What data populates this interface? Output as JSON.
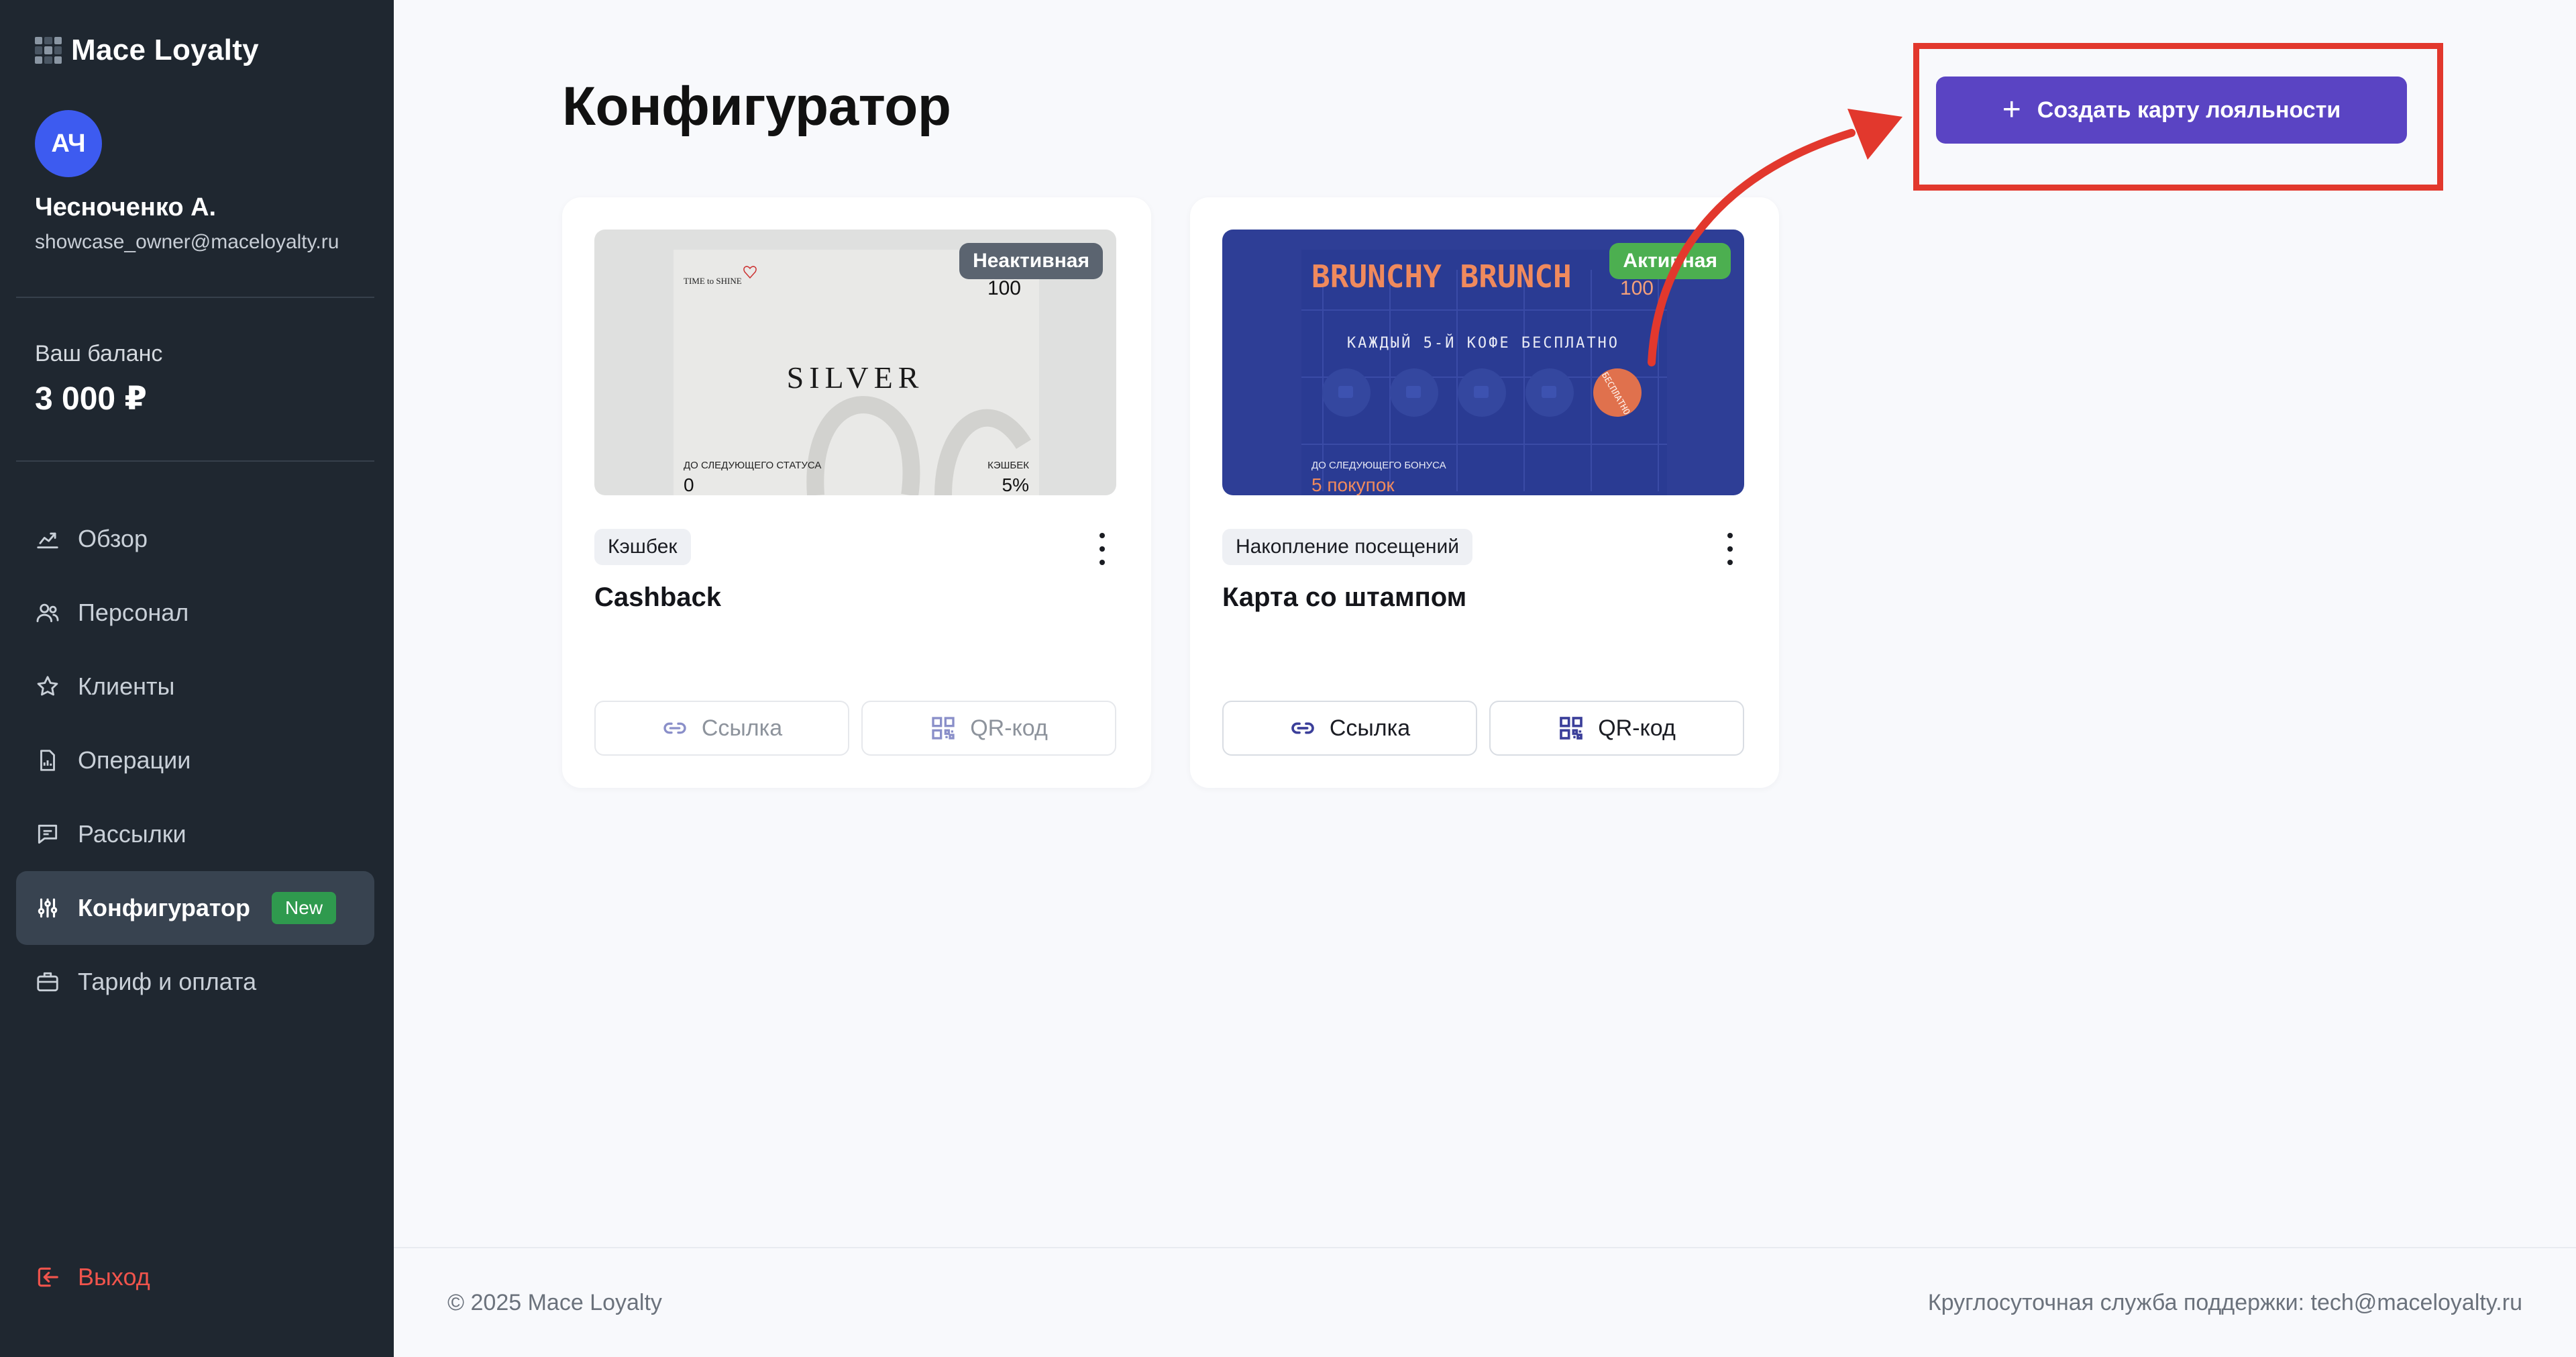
{
  "app": {
    "name": "Mace Loyalty"
  },
  "user": {
    "initials": "АЧ",
    "name": "Чесноченко А.",
    "email": "showcase_owner@maceloyalty.ru"
  },
  "balance": {
    "label": "Ваш баланс",
    "value": "3 000 ₽"
  },
  "nav": {
    "items": [
      {
        "label": "Обзор",
        "icon": "chart-icon"
      },
      {
        "label": "Персонал",
        "icon": "users-icon"
      },
      {
        "label": "Клиенты",
        "icon": "star-icon"
      },
      {
        "label": "Операции",
        "icon": "document-icon"
      },
      {
        "label": "Рассылки",
        "icon": "message-icon"
      },
      {
        "label": "Конфигуратор",
        "icon": "sliders-icon",
        "active": true,
        "badge": "New"
      },
      {
        "label": "Тариф и оплата",
        "icon": "briefcase-icon"
      }
    ],
    "logout": "Выход"
  },
  "page": {
    "title": "Конфигуратор",
    "create_button": "Создать карту лояльности"
  },
  "cards": [
    {
      "status": "Неактивная",
      "status_color": "#5b6470",
      "tag": "Кэшбек",
      "name": "Cashback",
      "link_label": "Ссылка",
      "qr_label": "QR-код",
      "preview": {
        "brand": "TIME to SHINE",
        "top_value": "100",
        "title": "SILVER",
        "left_caption": "ДО СЛЕДУЮЩЕГО СТАТУСА",
        "left_value": "0",
        "right_caption": "КЭШБЕК",
        "right_value": "5%"
      }
    },
    {
      "status": "Активная",
      "status_color": "#4caf50",
      "tag": "Накопление посещений",
      "name": "Карта со штампом",
      "link_label": "Ссылка",
      "qr_label": "QR-код",
      "preview": {
        "brand": "BRUNCHY BRUNCH",
        "top_value": "100",
        "subtitle": "КАЖДЫЙ 5-Й КОФЕ БЕСПЛАТНО",
        "stamp_text": "БЕСПЛАТНО",
        "caption": "ДО СЛЕДУЮЩЕГО БОНУСА",
        "value": "5 покупок"
      }
    }
  ],
  "footer": {
    "copyright": "© 2025 Mace Loyalty",
    "support": "Круглосуточная служба поддержки: tech@maceloyalty.ru"
  },
  "colors": {
    "sidebar": "#1f2730",
    "accent": "#5a44c3",
    "highlight": "#e2382d",
    "logout": "#f0544c"
  }
}
